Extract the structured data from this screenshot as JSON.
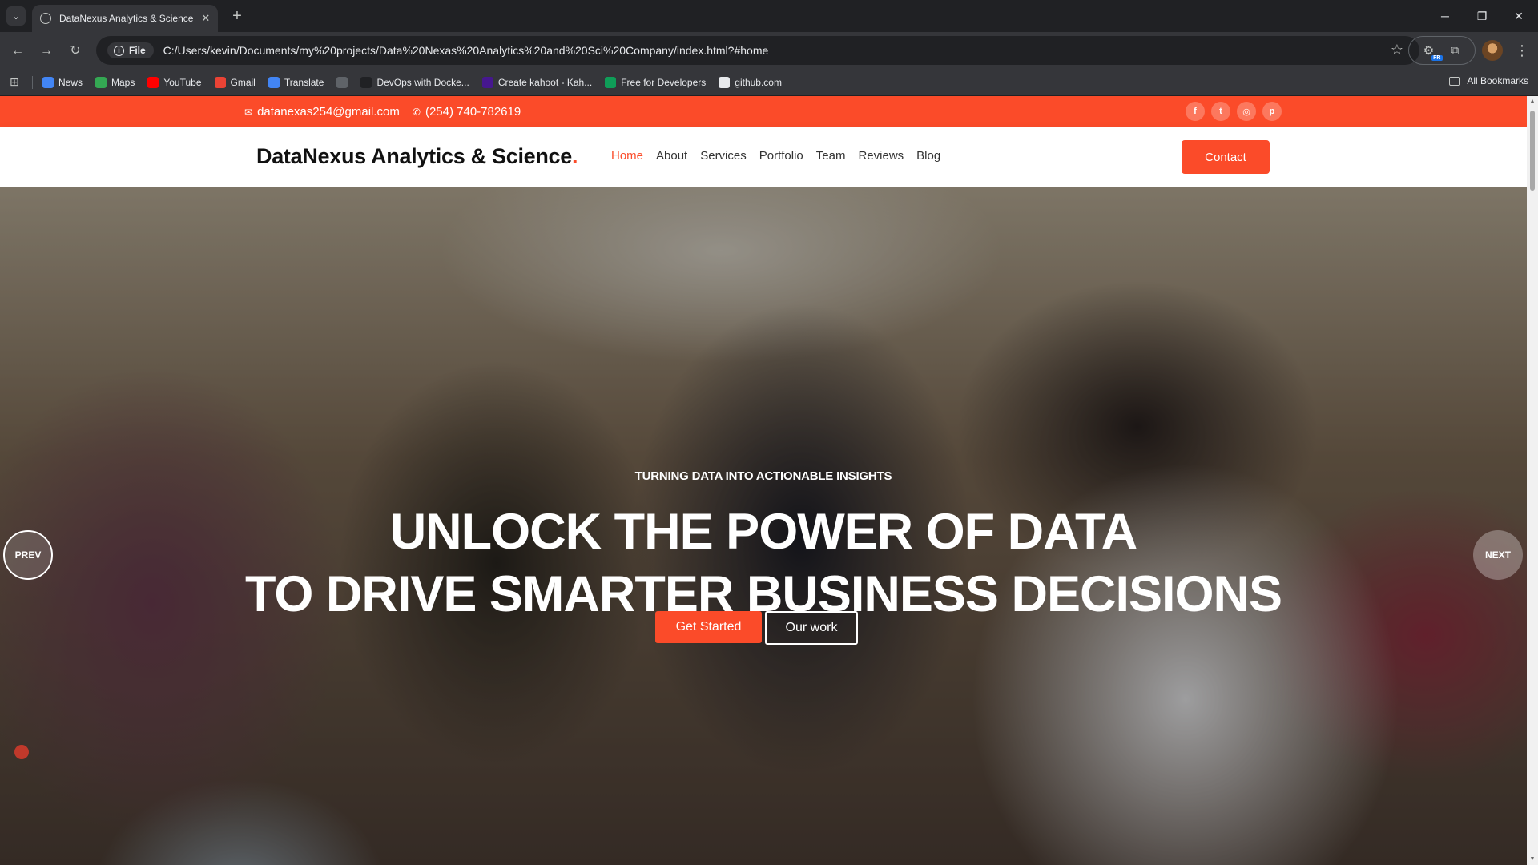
{
  "browser": {
    "tab_title": "DataNexus Analytics & Science",
    "chip_label": "File",
    "url": "C:/Users/kevin/Documents/my%20projects/Data%20Nexas%20Analytics%20and%20Sci%20Company/index.html?#home",
    "bookmarks": [
      {
        "label": "News",
        "icon_color": "#4285f4",
        "icon": "news-icon"
      },
      {
        "label": "Maps",
        "icon_color": "#34a853",
        "icon": "maps-icon"
      },
      {
        "label": "YouTube",
        "icon_color": "#ff0000",
        "icon": "youtube-icon"
      },
      {
        "label": "Gmail",
        "icon_color": "#ea4335",
        "icon": "gmail-icon"
      },
      {
        "label": "Translate",
        "icon_color": "#4285f4",
        "icon": "translate-icon"
      },
      {
        "label": "",
        "icon_color": "#5f6368",
        "icon": "globe-icon"
      },
      {
        "label": "DevOps with Docke...",
        "icon_color": "#202124",
        "icon": "devops-icon"
      },
      {
        "label": "Create kahoot - Kah...",
        "icon_color": "#46178f",
        "icon": "kahoot-icon"
      },
      {
        "label": "Free for Developers",
        "icon_color": "#0f9d58",
        "icon": "free-dev-icon"
      },
      {
        "label": "github.com",
        "icon_color": "#e8eaed",
        "icon": "github-icon"
      }
    ],
    "all_bookmarks": "All Bookmarks",
    "extension_badge": "FR"
  },
  "site": {
    "accent": "#fb4b29",
    "topbar": {
      "email": "datanexas254@gmail.com",
      "phone": "(254) 740-782619",
      "social": [
        {
          "icon": "facebook-icon",
          "glyph": "f"
        },
        {
          "icon": "twitter-icon",
          "glyph": "t"
        },
        {
          "icon": "instagram-icon",
          "glyph": "◎"
        },
        {
          "icon": "pinterest-icon",
          "glyph": "p"
        }
      ]
    },
    "header": {
      "logo": "DataNexus Analytics & Science",
      "logo_dot": ".",
      "nav": [
        "Home",
        "About",
        "Services",
        "Portfolio",
        "Team",
        "Reviews",
        "Blog"
      ],
      "active_nav": "Home",
      "cta": "Contact"
    },
    "hero": {
      "subtitle": "TURNING DATA INTO ACTIONABLE INSIGHTS",
      "title_line1": "UNLOCK THE POWER OF DATA",
      "title_line2": "TO DRIVE SMARTER BUSINESS DECISIONS",
      "primary_button": "Get Started",
      "secondary_button": "Our work",
      "prev": "PREV",
      "next": "NEXT"
    }
  }
}
